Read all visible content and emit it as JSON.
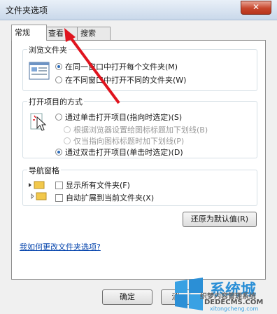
{
  "window": {
    "title": "文件夹选项",
    "close_label": "✕"
  },
  "tabs": [
    {
      "label": "常规"
    },
    {
      "label": "查看"
    },
    {
      "label": "搜索"
    }
  ],
  "browse": {
    "legend": "浏览文件夹",
    "options": [
      {
        "label": "在同一窗口中打开每个文件夹(M)",
        "selected": true
      },
      {
        "label": "在不同窗口中打开不同的文件夹(W)",
        "selected": false
      }
    ]
  },
  "open": {
    "legend": "打开项目的方式",
    "single_click": "通过单击打开项目(指向时选定)(S)",
    "underline_browser": "根据浏览器设置给图标标题加下划线(B)",
    "underline_point": "仅当指向图标标题时加下划线(P)",
    "double_click": "通过双击打开项目(单击时选定)(D)"
  },
  "nav": {
    "legend": "导航窗格",
    "show_all": "显示所有文件夹(F)",
    "auto_expand": "自动扩展到当前文件夹(X)"
  },
  "restore_button": "还原为默认值(R)",
  "help_link": "我如何更改文件夹选项?",
  "buttons": {
    "ok": "确定",
    "cancel": "消"
  },
  "watermark": {
    "line1": "系统城",
    "line2": "织梦内容管理系统",
    "line3": "DEDECMS.COM",
    "line4": "xitongcheng.com"
  },
  "accent_color": "#e0141e"
}
